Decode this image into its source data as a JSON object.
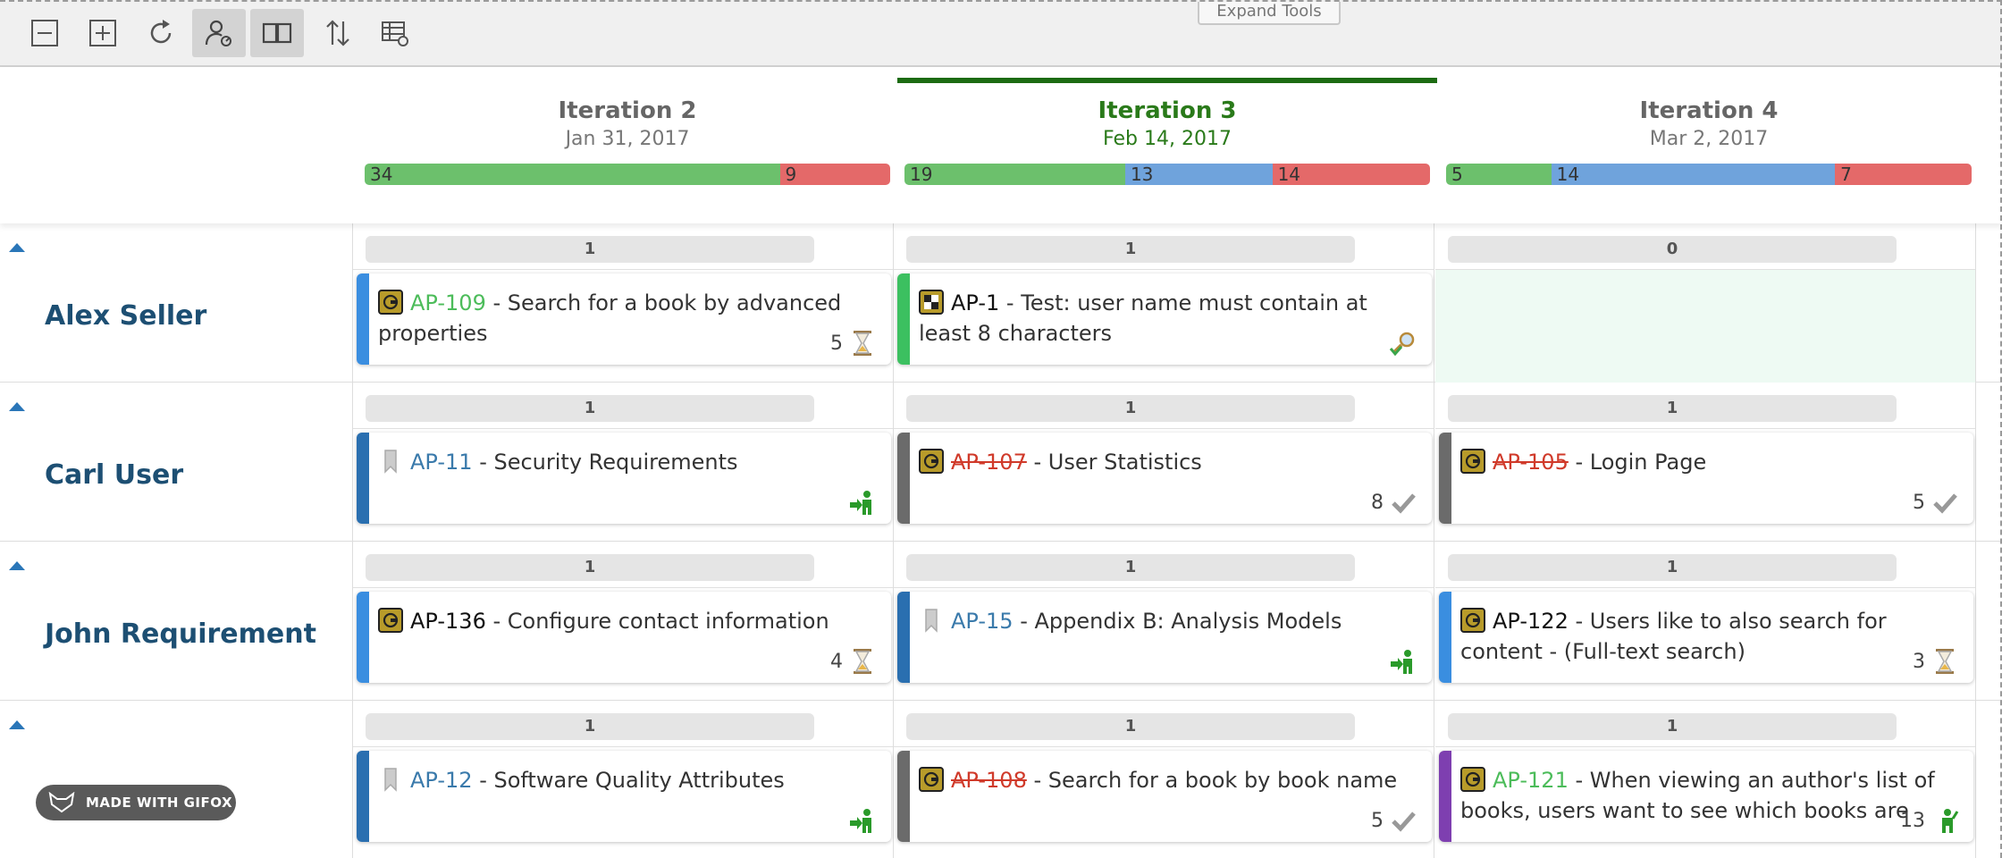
{
  "toolbar": {
    "buttons": [
      {
        "name": "collapse-all-icon"
      },
      {
        "name": "expand-all-icon"
      },
      {
        "name": "refresh-icon"
      },
      {
        "name": "user-settings-icon",
        "active": true
      },
      {
        "name": "split-view-icon",
        "active": true
      },
      {
        "name": "sort-icon"
      },
      {
        "name": "table-settings-icon"
      }
    ],
    "expand_tools": "Expand Tools"
  },
  "iterations": [
    {
      "title": "Iteration 2",
      "date": "Jan 31, 2017",
      "current": false,
      "stats": [
        {
          "color": "green",
          "value": "34",
          "fraction": 0.79
        },
        {
          "color": "red",
          "value": "9",
          "fraction": 0.21
        }
      ]
    },
    {
      "title": "Iteration 3",
      "date": "Feb 14, 2017",
      "current": true,
      "stats": [
        {
          "color": "green",
          "value": "19",
          "fraction": 0.42
        },
        {
          "color": "blue",
          "value": "13",
          "fraction": 0.28
        },
        {
          "color": "red",
          "value": "14",
          "fraction": 0.3
        }
      ]
    },
    {
      "title": "Iteration 4",
      "date": "Mar 2, 2017",
      "current": false,
      "stats": [
        {
          "color": "green",
          "value": "5",
          "fraction": 0.2
        },
        {
          "color": "blue",
          "value": "14",
          "fraction": 0.54
        },
        {
          "color": "red",
          "value": "7",
          "fraction": 0.26
        }
      ]
    }
  ],
  "rows": [
    {
      "member": "Alex Seller",
      "cells": [
        {
          "count": "1",
          "card": {
            "key": "AP-109",
            "key_style": "green",
            "title": " - Search for a book by advanced properties",
            "type": "feature",
            "stripe": "#3a8ee0",
            "estimate": "5",
            "status": "hourglass"
          }
        },
        {
          "count": "1",
          "card": {
            "key": "AP-1",
            "key_style": "black",
            "title": " - Test: user name must contain at least 8 characters",
            "type": "test",
            "stripe": "#3cc060",
            "estimate": "",
            "status": "search-check"
          }
        },
        {
          "count": "0",
          "card": null
        }
      ]
    },
    {
      "member": "Carl User",
      "cells": [
        {
          "count": "1",
          "card": {
            "key": "AP-11",
            "key_style": "blue",
            "title": " - Security Requirements",
            "type": "bookmark",
            "stripe": "#2a6fb0",
            "estimate": "",
            "status": "user-enter"
          }
        },
        {
          "count": "1",
          "card": {
            "key": "AP-107",
            "key_style": "red",
            "title": " - User Statistics",
            "type": "feature",
            "stripe": "#6b6b6b",
            "estimate": "8",
            "status": "check"
          }
        },
        {
          "count": "1",
          "card": {
            "key": "AP-105",
            "key_style": "red",
            "title": " - Login Page",
            "type": "feature",
            "stripe": "#6b6b6b",
            "estimate": "5",
            "status": "check"
          }
        }
      ]
    },
    {
      "member": "John Requirement",
      "cells": [
        {
          "count": "1",
          "card": {
            "key": "AP-136",
            "key_style": "black",
            "title": " - Configure contact information",
            "type": "feature",
            "stripe": "#3a8ee0",
            "estimate": "4",
            "status": "hourglass"
          }
        },
        {
          "count": "1",
          "card": {
            "key": "AP-15",
            "key_style": "blue",
            "title": " - Appendix B: Analysis Models",
            "type": "bookmark",
            "stripe": "#2a6fb0",
            "estimate": "",
            "status": "user-enter"
          }
        },
        {
          "count": "1",
          "card": {
            "key": "AP-122",
            "key_style": "black",
            "title": " - Users like to also search for content - (Full-text search)",
            "type": "feature",
            "stripe": "#3a8ee0",
            "estimate": "3",
            "status": "hourglass"
          }
        }
      ]
    },
    {
      "member": "",
      "cells": [
        {
          "count": "1",
          "card": {
            "key": "AP-12",
            "key_style": "blue",
            "title": " - Software Quality Attributes",
            "type": "bookmark",
            "stripe": "#2a6fb0",
            "estimate": "",
            "status": "user-enter"
          }
        },
        {
          "count": "1",
          "card": {
            "key": "AP-108",
            "key_style": "red",
            "title": " - Search for a book by book name",
            "type": "feature",
            "stripe": "#6b6b6b",
            "estimate": "5",
            "status": "check"
          }
        },
        {
          "count": "1",
          "card": {
            "key": "AP-121",
            "key_style": "green",
            "title": " - When viewing an author's list of books, users want to see which books are",
            "type": "feature",
            "stripe": "#7e3fb0",
            "estimate": "13",
            "status": "user-up"
          }
        }
      ]
    }
  ],
  "watermark": "MADE WITH GIFOX"
}
